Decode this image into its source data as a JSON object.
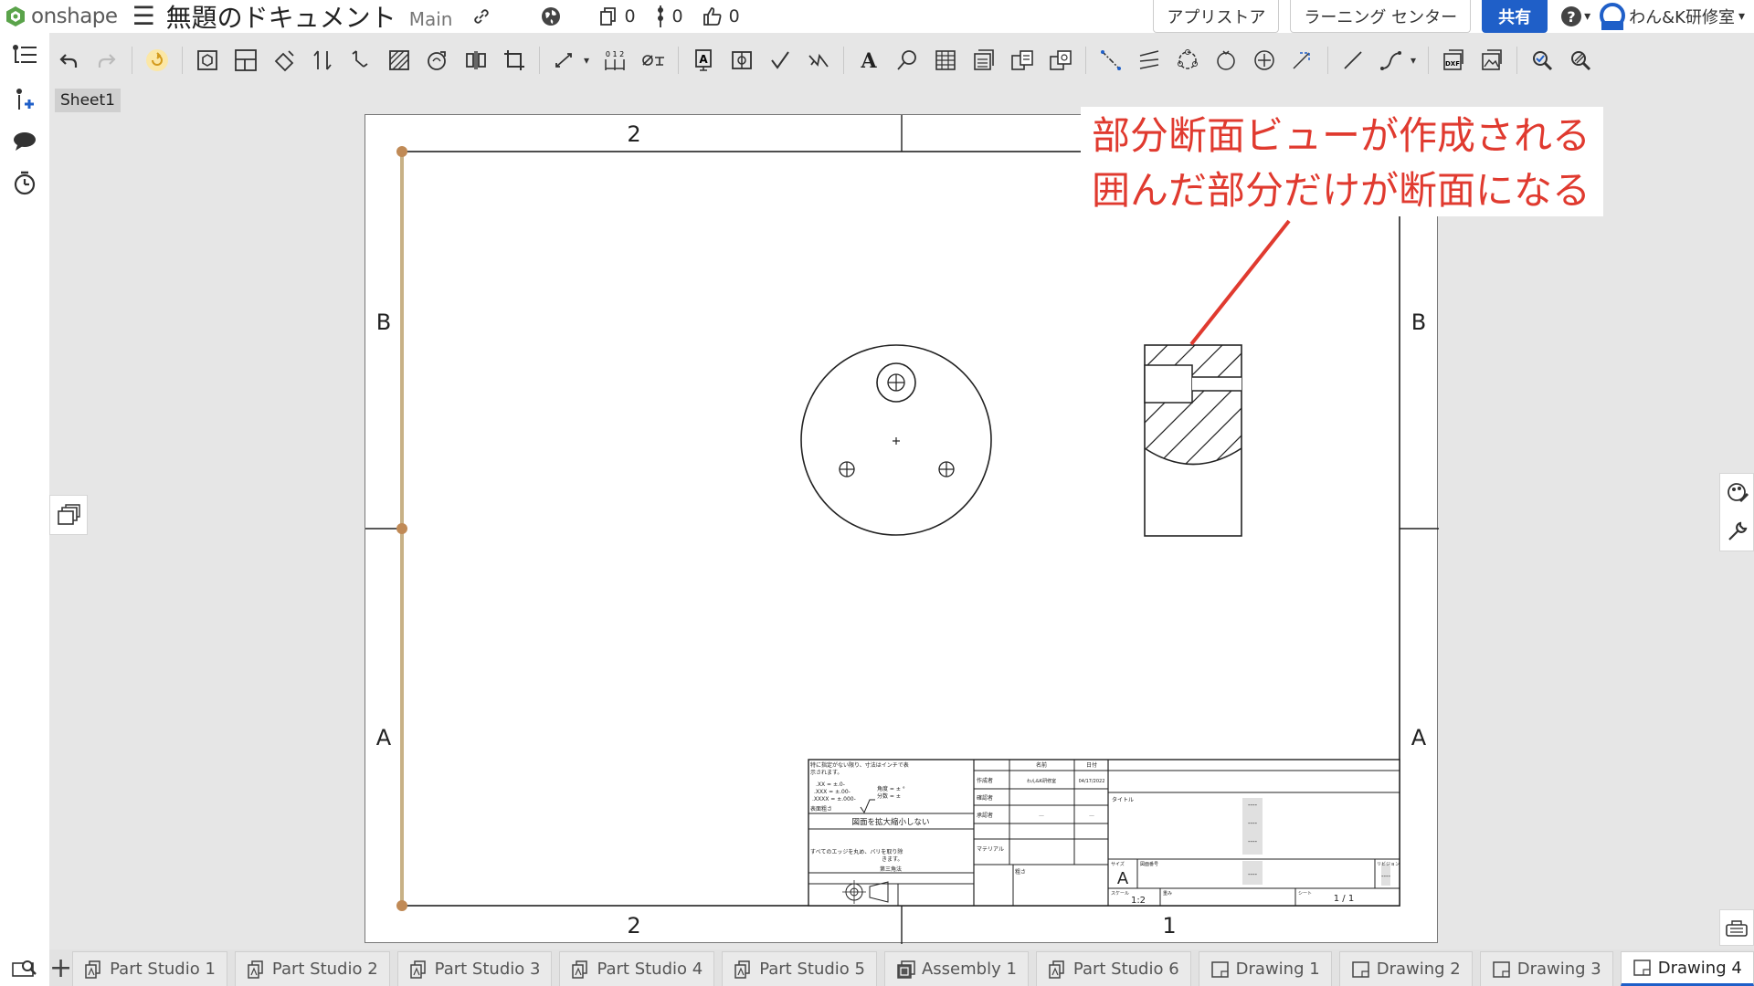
{
  "app": {
    "logo_text": "onshape",
    "doc_title": "無題のドキュメント",
    "branch": "Main",
    "versions_count": "0",
    "branches_count": "0",
    "likes_count": "0"
  },
  "header_buttons": {
    "app_store": "アプリストア",
    "learning_center": "ラーニング センター",
    "share": "共有",
    "user_name": "わん&K研修室"
  },
  "sheet_tab": "Sheet1",
  "drawing": {
    "zone_top_left": "2",
    "zone_bottom_left": "2",
    "zone_bottom_right": "1",
    "row_b_left": "B",
    "row_a_left": "A",
    "row_b_right": "B",
    "row_a_right": "A",
    "title_block": {
      "note_line1": "特に指定がない限り、寸法はインチで表",
      "note_line2": "示されます。",
      "tol_xx": ".XX = ±.0-",
      "tol_xxx": ".XXX = ±.00-",
      "tol_xxxx": ".XXXX = ±.000-",
      "angle_tol": "角度 = ± °",
      "fraction_tol": "分数 = ±",
      "surface_finish": "表面粗さ",
      "no_scale": "図面を拡大縮小しない",
      "edges_note_line1": "すべてのエッジを丸め、バリを取り除",
      "edges_note_line2": "きます。",
      "projection": "第三角法",
      "col_name": "名前",
      "col_date": "日付",
      "row_author": "作成者",
      "row_checker": "確認者",
      "row_approver": "承認者",
      "author_name": "わん&K研修室",
      "author_date": "04/17/2022",
      "approver_name": "—",
      "approver_date": "—",
      "material": "マテリアル",
      "finish": "粗さ",
      "title_label": "タイトル",
      "size_label": "サイズ",
      "size_value": "A",
      "drawing_number_label": "図面番号",
      "revision_label": "リビジョン",
      "scale_label": "スケール",
      "scale_value": "1:2",
      "weight_label": "重み",
      "sheet_label": "シート",
      "sheet_value": "1 / 1",
      "dash": "----"
    }
  },
  "annotation": {
    "line1": "部分断面ビューが作成される",
    "line2": "囲んだ部分だけが断面になる",
    "color": "#e03a2f"
  },
  "bottom_tabs": [
    {
      "label": "Part Studio 1",
      "icon": "part-studio-icon"
    },
    {
      "label": "Part Studio 2",
      "icon": "part-studio-icon"
    },
    {
      "label": "Part Studio 3",
      "icon": "part-studio-icon"
    },
    {
      "label": "Part Studio 4",
      "icon": "part-studio-icon"
    },
    {
      "label": "Part Studio 5",
      "icon": "part-studio-icon"
    },
    {
      "label": "Assembly 1",
      "icon": "assembly-icon"
    },
    {
      "label": "Part Studio 6",
      "icon": "part-studio-icon"
    },
    {
      "label": "Drawing 1",
      "icon": "drawing-icon"
    },
    {
      "label": "Drawing 2",
      "icon": "drawing-icon"
    },
    {
      "label": "Drawing 3",
      "icon": "drawing-icon"
    },
    {
      "label": "Drawing 4",
      "icon": "drawing-icon",
      "active": true
    }
  ],
  "colors": {
    "accent": "#1f5fc8",
    "handle": "#c8a678",
    "handle_dot": "#c08a56"
  }
}
